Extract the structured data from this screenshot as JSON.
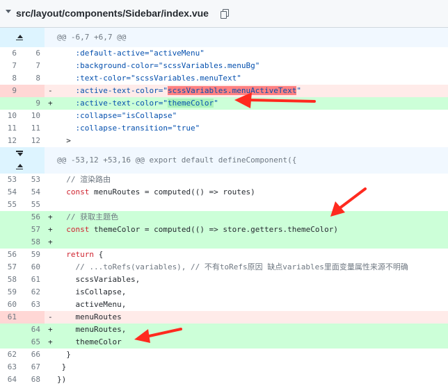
{
  "header": {
    "file_path": "src/layout/components/Sidebar/index.vue"
  },
  "hunks": [
    {
      "text": "@@ -6,7 +6,7 @@"
    },
    {
      "text": "@@ -53,12 +53,16 @@ export default defineComponent({"
    }
  ],
  "lines": [
    {
      "old": "6",
      "new": "6",
      "type": "ctx",
      "code": "    :default-active=\"activeMenu\""
    },
    {
      "old": "7",
      "new": "7",
      "type": "ctx",
      "code": "    :background-color=\"scssVariables.menuBg\""
    },
    {
      "old": "8",
      "new": "8",
      "type": "ctx",
      "code": "    :text-color=\"scssVariables.menuText\""
    },
    {
      "old": "9",
      "new": "",
      "type": "del",
      "sign": "-",
      "code_pre": "    :active-text-color=\"",
      "code_hl": "scssVariables.menuActiveText",
      "code_post": "\""
    },
    {
      "old": "",
      "new": "9",
      "type": "add",
      "sign": "+",
      "code_pre": "    :active-text-color=\"",
      "code_hl": "themeColor",
      "code_post": "\""
    },
    {
      "old": "10",
      "new": "10",
      "type": "ctx",
      "code": "    :collapse=\"isCollapse\""
    },
    {
      "old": "11",
      "new": "11",
      "type": "ctx",
      "code": "    :collapse-transition=\"true\""
    },
    {
      "old": "12",
      "new": "12",
      "type": "ctx",
      "code": "  >"
    },
    {
      "old": "53",
      "new": "53",
      "type": "ctx",
      "code": "  // 渲染路由"
    },
    {
      "old": "54",
      "new": "54",
      "type": "ctx",
      "code": "  const menuRoutes = computed(() => routes)"
    },
    {
      "old": "55",
      "new": "55",
      "type": "ctx",
      "code": ""
    },
    {
      "old": "",
      "new": "56",
      "type": "add",
      "sign": "+",
      "code": "  // 获取主题色"
    },
    {
      "old": "",
      "new": "57",
      "type": "add",
      "sign": "+",
      "code": "  const themeColor = computed(() => store.getters.themeColor)"
    },
    {
      "old": "",
      "new": "58",
      "type": "add",
      "sign": "+",
      "code": ""
    },
    {
      "old": "56",
      "new": "59",
      "type": "ctx",
      "code": "  return {"
    },
    {
      "old": "57",
      "new": "60",
      "type": "ctx",
      "code": "    // ...toRefs(variables), // 不有toRefs原因 缺点variables里面变量属性来源不明确"
    },
    {
      "old": "58",
      "new": "61",
      "type": "ctx",
      "code": "    scssVariables,"
    },
    {
      "old": "59",
      "new": "62",
      "type": "ctx",
      "code": "    isCollapse,"
    },
    {
      "old": "60",
      "new": "63",
      "type": "ctx",
      "code": "    activeMenu,"
    },
    {
      "old": "61",
      "new": "",
      "type": "del",
      "sign": "-",
      "code": "    menuRoutes"
    },
    {
      "old": "",
      "new": "64",
      "type": "add",
      "sign": "+",
      "code": "    menuRoutes,"
    },
    {
      "old": "",
      "new": "65",
      "type": "add",
      "sign": "+",
      "code": "    themeColor"
    },
    {
      "old": "62",
      "new": "66",
      "type": "ctx",
      "code": "  }"
    },
    {
      "old": "63",
      "new": "67",
      "type": "ctx",
      "code": " }"
    },
    {
      "old": "64",
      "new": "68",
      "type": "ctx",
      "code": "})"
    }
  ],
  "colors": {
    "add_bg": "#e6ffec",
    "del_bg": "#ffebe9",
    "hunk_bg": "#f1f8ff",
    "arrow": "#ff2a1f"
  }
}
